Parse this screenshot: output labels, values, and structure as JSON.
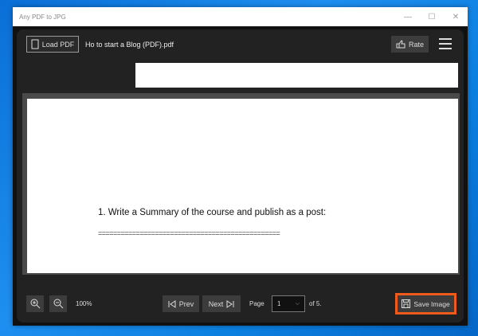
{
  "window": {
    "title": "Any PDF to JPG",
    "minimize": "—",
    "maximize": "☐",
    "close": "✕"
  },
  "toolbar": {
    "load_label": "Load PDF",
    "file_name": "Ho to start a Blog (PDF).pdf",
    "rate_label": "Rate"
  },
  "document": {
    "heading": "1. Write a Summary of the course and publish as a post:",
    "rule": "================================================"
  },
  "footer": {
    "zoom_level": "100%",
    "prev_label": "Prev",
    "next_label": "Next",
    "page_label": "Page",
    "page_value": "1",
    "page_total": "of 5.",
    "save_label": "Save Image"
  },
  "colors": {
    "accent": "#f05a1a"
  }
}
